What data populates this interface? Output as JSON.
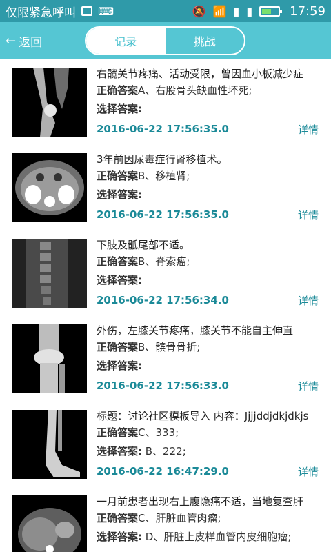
{
  "status_bar": {
    "carrier": "仅限紧急呼叫",
    "time": "17:59",
    "icons": [
      "image-icon",
      "keyboard-icon",
      "mute-icon",
      "wifi-icon",
      "sim1-icon",
      "sim2-icon",
      "battery-icon"
    ],
    "battery_level_fraction": 0.6
  },
  "header": {
    "back_label": "返回",
    "tabs": [
      {
        "label": "记录",
        "active": true
      },
      {
        "label": "挑战",
        "active": false
      }
    ]
  },
  "labels": {
    "correct": "正确答案",
    "selected": "选择答案:",
    "detail": "详情"
  },
  "records": [
    {
      "desc": "右髋关节疼痛、活动受限，曾因血小板减少症",
      "correct": "A、右股骨头缺血性坏死;",
      "selected": "",
      "date": "2016-06-22 17:56:35.0",
      "thumb": "pelvis-xray"
    },
    {
      "desc": "3年前因尿毒症行肾移植术。",
      "correct": "B、移植肾;",
      "selected": "",
      "date": "2016-06-22 17:56:35.0",
      "thumb": "abdomen-ct"
    },
    {
      "desc": "下肢及骶尾部不适。",
      "correct": "B、脊索瘤;",
      "selected": "",
      "date": "2016-06-22 17:56:34.0",
      "thumb": "spine-mri"
    },
    {
      "desc": "外伤，左膝关节疼痛，膝关节不能自主伸直",
      "correct": "B、髌骨骨折;",
      "selected": "",
      "date": "2016-06-22 17:56:33.0",
      "thumb": "knee-xray"
    },
    {
      "desc": "标题：讨论社区模板导入  内容：Jjjjddjdkjdkjs",
      "correct": "C、333;",
      "selected": " B、222;",
      "date": "2016-06-22 16:47:29.0",
      "thumb": "ankle-xray"
    },
    {
      "desc": "一月前患者出现右上腹隐痛不适，当地复查肝",
      "correct": "C、肝脏血管肉瘤;",
      "selected": " D、肝脏上皮样血管内皮细胞瘤;",
      "date": "",
      "thumb": "liver-ct"
    }
  ]
}
